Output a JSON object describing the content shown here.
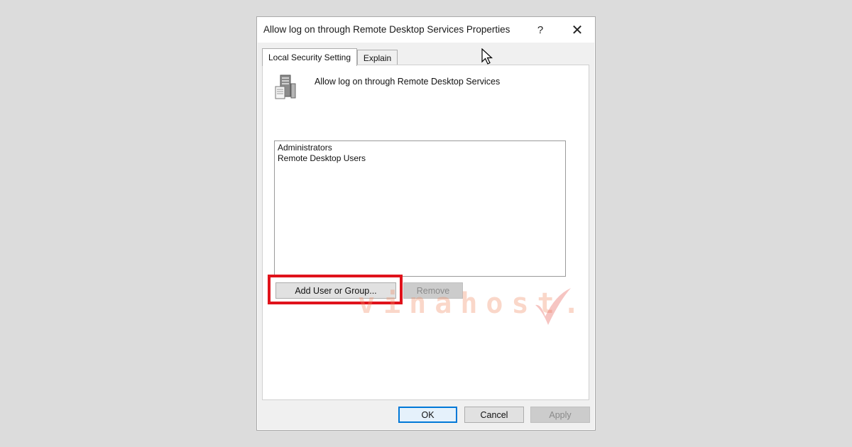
{
  "window": {
    "title": "Allow log on through Remote Desktop Services Properties",
    "help_label": "?",
    "close_label": "✕"
  },
  "tabs": [
    {
      "label": "Local Security Setting",
      "active": true
    },
    {
      "label": "Explain",
      "active": false
    }
  ],
  "policy": {
    "name": "Allow log on through Remote Desktop Services",
    "icon": "server-policy-icon"
  },
  "members": [
    "Administrators",
    "Remote Desktop Users"
  ],
  "buttons": {
    "add": "Add User or Group...",
    "remove": "Remove",
    "ok": "OK",
    "cancel": "Cancel",
    "apply": "Apply"
  },
  "watermark": {
    "text": "vinahost."
  },
  "colors": {
    "highlight": "#e0121b",
    "accent": "#0078d7"
  }
}
